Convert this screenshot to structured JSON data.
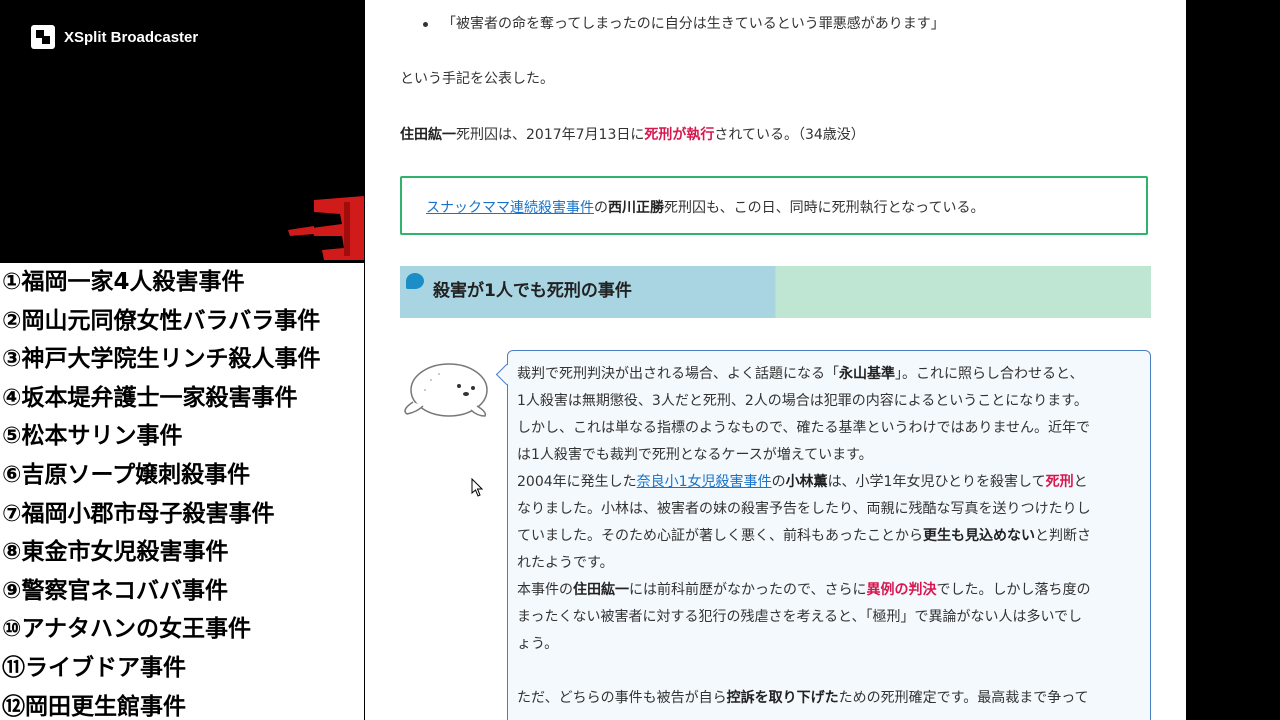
{
  "overlay": {
    "brand": "XSplit Broadcaster",
    "cases": [
      "①福岡一家4人殺害事件",
      "②岡山元同僚女性バラバラ事件",
      "③神戸大学院生リンチ殺人事件",
      "④坂本堤弁護士一家殺害事件",
      "⑤松本サリン事件",
      "⑥吉原ソープ嬢刺殺事件",
      "⑦福岡小郡市母子殺害事件",
      "⑧東金市女児殺害事件",
      "⑨警察官ネコババ事件",
      "⑩アナタハンの女王事件",
      "⑪ライブドア事件",
      "⑫岡田更生館事件"
    ]
  },
  "article": {
    "quote": "「被害者の命を奪ってしまったのに自分は生きているという罪悪感があります」",
    "p1": "という手記を公表した。",
    "p2": {
      "name": "住田紘一",
      "t1": "死刑囚は、2017年7月13日に",
      "red": "死刑が執行",
      "t2": "されている。（34歳没）"
    },
    "info": {
      "link": "スナックママ連続殺害事件",
      "t1": "の",
      "name": "西川正勝",
      "t2": "死刑囚も、この日、同時に死刑執行となっている。"
    },
    "heading": "殺害が1人でも死刑の事件",
    "speech": {
      "l1a": "裁判で死刑判決が出される場合、よく話題になる「",
      "l1b": "永山基準",
      "l1c": "」。これに照らし合わせると、",
      "l2": "1人殺害は無期懲役、3人だと死刑、2人の場合は犯罪の内容によるということになります。",
      "l3": "しかし、これは単なる指標のようなもので、確たる基準というわけではありません。近年で",
      "l4": "は1人殺害でも裁判で死刑となるケースが増えています。",
      "l5a": "2004年に発生した",
      "l5link": "奈良小1女児殺害事件",
      "l5b": "の",
      "l5name": "小林薫",
      "l5c": "は、小学1年女児ひとりを殺害して",
      "l5red": "死刑",
      "l5d": "と",
      "l6": "なりました。小林は、被害者の妹の殺害予告をしたり、両親に残酷な写真を送りつけたりし",
      "l7a": "ていました。そのため心証が著しく悪く、前科もあったことから",
      "l7b": "更生も見込めない",
      "l7c": "と判断さ",
      "l8": "れたようです。",
      "l9a": "本事件の",
      "l9name": "住田紘一",
      "l9b": "には前科前歴がなかったので、さらに",
      "l9red": "異例の判決",
      "l9c": "でした。しかし落ち度の",
      "l10": "まったくない被害者に対する犯行の残虐さを考えると、「極刑」で異論がない人は多いでし",
      "l11": "ょう。",
      "l12a": "ただ、どちらの事件も被告が自ら",
      "l12b": "控訴を取り下げた",
      "l12c": "ための死刑確定です。最高裁まで争って"
    }
  }
}
